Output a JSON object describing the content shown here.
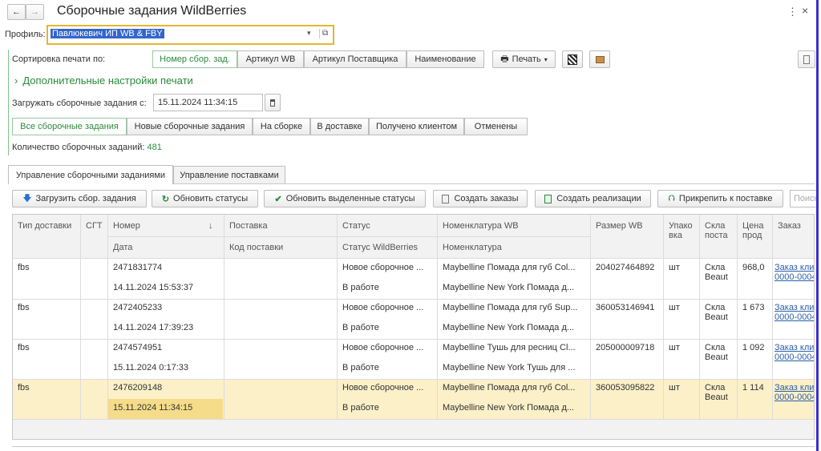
{
  "window": {
    "title": "Сборочные задания WildBerries",
    "back_icon": "←",
    "forward_icon": "→",
    "more_icon": "⋮",
    "close_icon": "×"
  },
  "profile": {
    "label": "Профиль:",
    "value": "Павлюкевич ИП WB & FBY"
  },
  "print_sort": {
    "label": "Сортировка печати по:",
    "options": [
      "Номер сбор. зад.",
      "Артикул WB",
      "Артикул Поставщика",
      "Наименование"
    ],
    "active_index": 0,
    "print_button": "Печать"
  },
  "extra_settings": {
    "label": "Дополнительные настройки печати"
  },
  "load_from": {
    "label": "Загружать сборочные задания с:",
    "value": "15.11.2024 11:34:15"
  },
  "filters": {
    "items": [
      "Все сборочные задания",
      "Новые сборочные задания",
      "На сборке",
      "В доставке",
      "Получено клиентом",
      "Отменены"
    ],
    "active_index": 0
  },
  "count": {
    "label": "Количество сборочных заданий:",
    "value": "481"
  },
  "tabs": [
    "Управление сборочными заданиями",
    "Управление поставками"
  ],
  "toolbar": {
    "load": "Загрузить сбор. задания",
    "refresh": "Обновить статусы",
    "refresh_selected": "Обновить выделенные статусы",
    "create_orders": "Создать заказы",
    "create_sales": "Создать реализации",
    "attach": "Прикрепить к поставке",
    "search_placeholder": "Поиск"
  },
  "table": {
    "headers": {
      "delivery_type": "Тип доставки",
      "sgt": "СГТ",
      "number": "Номер",
      "date": "Дата",
      "supply": "Поставка",
      "supply_code": "Код поставки",
      "status": "Статус",
      "status_wb": "Статус WildBerries",
      "nomenclature_wb": "Номенклатура WB",
      "nomenclature": "Номенклатура",
      "size_wb": "Размер WB",
      "pack": "Упако вка",
      "warehouse": "Скла поста",
      "price": "Цена прод",
      "order": "Заказ"
    },
    "rows": [
      {
        "delivery_type": "fbs",
        "number": "2471831774",
        "date": "14.11.2024 15:53:37",
        "status": "Новое сборочное ...",
        "status_wb": "В работе",
        "nomenclature_wb": "Maybelline Помада для губ Col...",
        "nomenclature": "Maybelline New York Помада д...",
        "size_wb": "204027464892",
        "pack": "шт",
        "warehouse": "Скла Beaut",
        "price": "968,0",
        "order1": "Заказ кли",
        "order2": "0000-0004"
      },
      {
        "delivery_type": "fbs",
        "number": "2472405233",
        "date": "14.11.2024 17:39:23",
        "status": "Новое сборочное ...",
        "status_wb": "В работе",
        "nomenclature_wb": "Maybelline Помада для губ Sup...",
        "nomenclature": "Maybelline New York Помада д...",
        "size_wb": "360053146941",
        "pack": "шт",
        "warehouse": "Скла Beaut",
        "price": "1 673",
        "order1": "Заказ кли",
        "order2": "0000-0004"
      },
      {
        "delivery_type": "fbs",
        "number": "2474574951",
        "date": "15.11.2024 0:17:33",
        "status": "Новое сборочное ...",
        "status_wb": "В работе",
        "nomenclature_wb": "Maybelline Тушь для ресниц Cl...",
        "nomenclature": "Maybelline New York Тушь для ...",
        "size_wb": "205000009718",
        "pack": "шт",
        "warehouse": "Скла Beaut",
        "price": "1 092",
        "order1": "Заказ кли",
        "order2": "0000-0004"
      },
      {
        "delivery_type": "fbs",
        "number": "2476209148",
        "date": "15.11.2024 11:34:15",
        "status": "Новое сборочное ...",
        "status_wb": "В работе",
        "nomenclature_wb": "Maybelline Помада для губ Col...",
        "nomenclature": "Maybelline New York Помада д...",
        "size_wb": "360053095822",
        "pack": "шт",
        "warehouse": "Скла Beaut",
        "price": "1 114",
        "order1": "Заказ кли",
        "order2": "0000-0004"
      }
    ],
    "selected_row": 3
  },
  "colors": {
    "accent_green": "#2a8a3a",
    "profile_highlight": "#3366cc",
    "selected_row": "#fbf0c8",
    "selected_cell": "#f5dc8a",
    "focus_border": "#e6b530",
    "right_edge": "#3a2fd0"
  }
}
